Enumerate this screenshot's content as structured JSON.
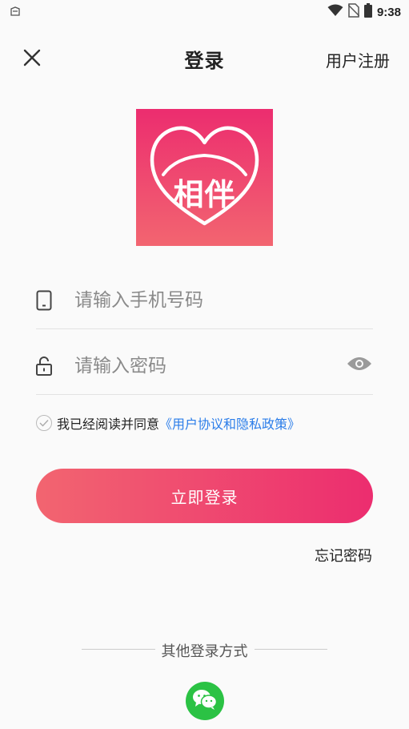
{
  "status_bar": {
    "time": "9:38"
  },
  "header": {
    "title": "登录",
    "register_label": "用户注册"
  },
  "logo": {
    "text": "相伴"
  },
  "form": {
    "phone_placeholder": "请输入手机号码",
    "password_placeholder": "请输入密码"
  },
  "agreement": {
    "text": "我已经阅读并同意",
    "link": "《用户协议和隐私政策》"
  },
  "login_button": "立即登录",
  "forgot_password": "忘记密码",
  "other_login": {
    "title": "其他登录方式",
    "wechat_icon": "wechat-icon"
  },
  "colors": {
    "brand_start": "#f26570",
    "brand_end": "#ec2d6f",
    "link": "#2b7de9",
    "wechat": "#2bc244"
  }
}
